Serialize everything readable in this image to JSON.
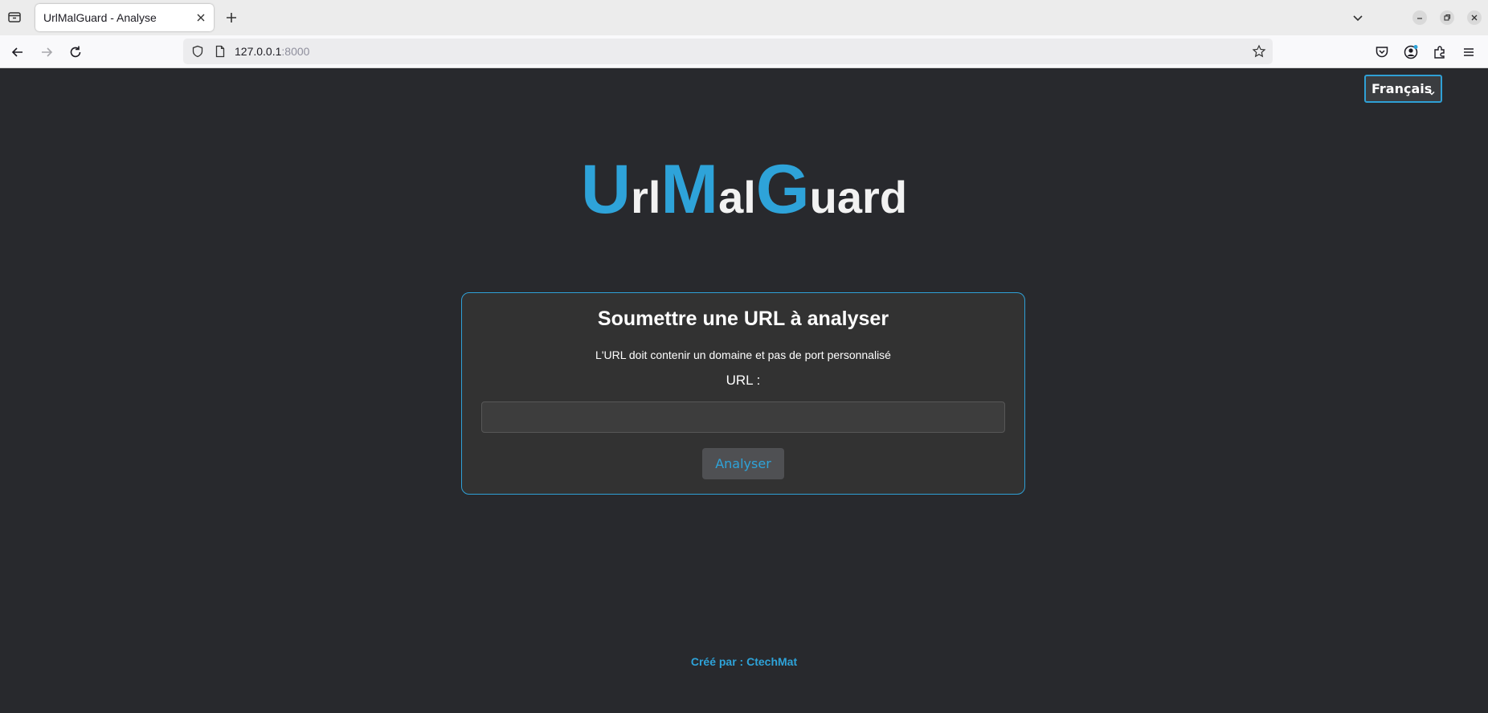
{
  "browser": {
    "tab": {
      "title": "UrlMalGuard - Analyse"
    },
    "address": {
      "host": "127.0.0.1",
      "port": ":8000"
    }
  },
  "language_select": {
    "selected": "Français"
  },
  "logo": {
    "parts": [
      "U",
      "rl",
      "M",
      "al",
      "G",
      "uard"
    ]
  },
  "form": {
    "title": "Soumettre une URL à analyser",
    "hint": "L'URL doit contenir un domaine et pas de port personnalisé",
    "url_label": "URL :",
    "url_value": "",
    "submit_label": "Analyser"
  },
  "footer": {
    "credit": "Créé par : CtechMat"
  },
  "colors": {
    "accent": "#2ea3d9",
    "background": "#28292d",
    "card": "#323232"
  },
  "icons": [
    "tab-list-icon",
    "close-icon",
    "plus-icon",
    "chevron-down-icon",
    "minimize-icon",
    "restore-icon",
    "back-arrow-icon",
    "forward-arrow-icon",
    "reload-icon",
    "shield-icon",
    "page-icon",
    "star-icon",
    "pocket-icon",
    "account-icon",
    "extensions-icon",
    "menu-icon"
  ]
}
